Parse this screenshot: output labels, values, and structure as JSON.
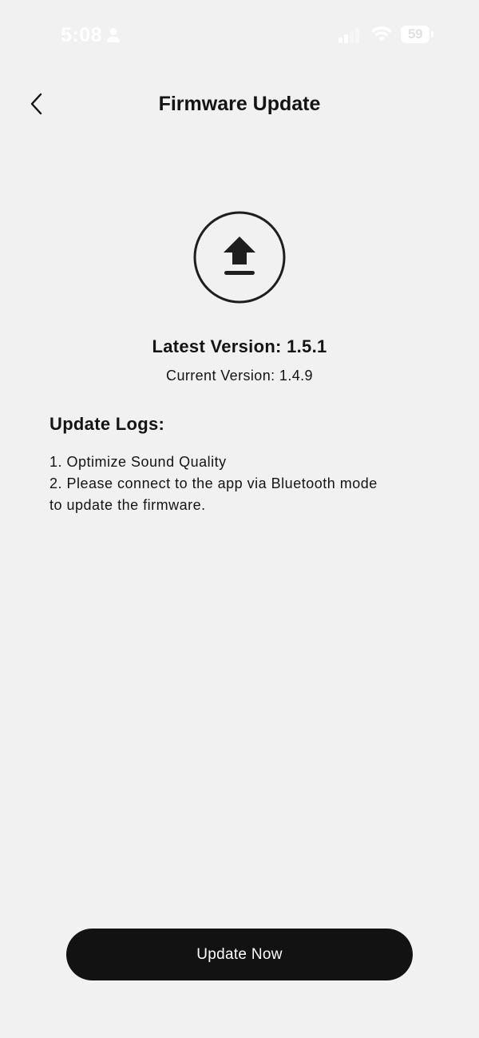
{
  "status_bar": {
    "time": "5:08",
    "battery": "59"
  },
  "header": {
    "title": "Firmware Update"
  },
  "version": {
    "latest": "Latest Version: 1.5.1",
    "current": "Current Version: 1.4.9"
  },
  "logs": {
    "heading": "Update Logs:",
    "lines": [
      "1. Optimize Sound Quality",
      "2. Please connect to the app via Bluetooth mode",
      "to update the firmware."
    ]
  },
  "actions": {
    "update_label": "Update Now"
  },
  "colors": {
    "background": "#f1f1f1",
    "text": "#141414",
    "button": "#121212",
    "button_text": "#ffffff"
  },
  "icons": {
    "back": "chevron-left-icon",
    "upload": "upload-icon"
  }
}
